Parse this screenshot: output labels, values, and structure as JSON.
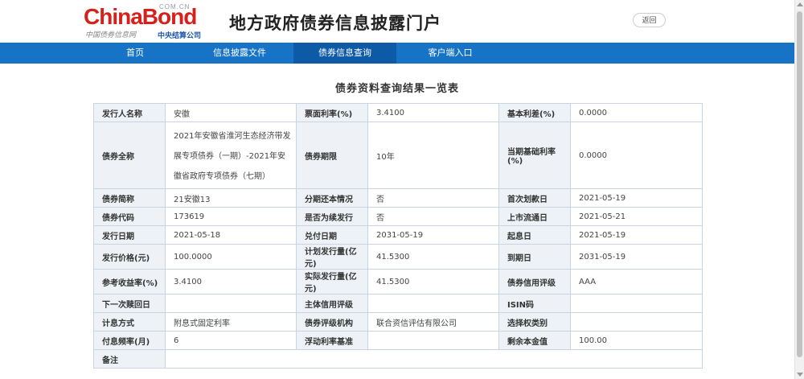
{
  "header": {
    "logo": {
      "brand_left": "China",
      "brand_right": "Bond",
      "domain": "COM.CN",
      "tagline_left": "中国债券信息网",
      "tagline_right": "中央结算公司"
    },
    "site_title": "地方政府债券信息披露门户",
    "back_label": "返回"
  },
  "nav": {
    "items": [
      {
        "label": "首页"
      },
      {
        "label": "信息披露文件"
      },
      {
        "label": "债券信息查询"
      },
      {
        "label": "客户端入口"
      }
    ],
    "active_index": 2
  },
  "page": {
    "title": "债券资料查询结果一览表"
  },
  "table": {
    "rows": [
      {
        "c": [
          "发行人名称",
          "安徽",
          "票面利率(%)",
          "3.4100",
          "基本利差(%)",
          "0.0000"
        ]
      },
      {
        "c": [
          "债券全称",
          "2021年安徽省淮河生态经济带发展专项债券（一期）-2021年安徽省政府专项债券（七期）",
          "债券期限",
          "10年",
          "当期基础利率(%)",
          "0.0000"
        ]
      },
      {
        "c": [
          "债券简称",
          "21安徽13",
          "分期还本情况",
          "否",
          "首次划款日",
          "2021-05-19"
        ]
      },
      {
        "c": [
          "债券代码",
          "173619",
          "是否为续发行",
          "否",
          "上市流通日",
          "2021-05-21"
        ]
      },
      {
        "c": [
          "发行日期",
          "2021-05-18",
          "兑付日期",
          "2031-05-19",
          "起息日",
          "2021-05-19"
        ]
      },
      {
        "c": [
          "发行价格(元)",
          "100.0000",
          "计划发行量(亿元)",
          "41.5300",
          "到期日",
          "2031-05-19"
        ]
      },
      {
        "c": [
          "参考收益率(%)",
          "3.4100",
          "实际发行量(亿元)",
          "41.5300",
          "债券信用评级",
          "AAA"
        ]
      },
      {
        "c": [
          "下一次赎回日",
          "",
          "主体信用评级",
          "",
          "ISIN码",
          ""
        ]
      },
      {
        "c": [
          "计息方式",
          "附息式固定利率",
          "债券评级机构",
          "联合资信评估有限公司",
          "选择权类别",
          ""
        ]
      },
      {
        "c": [
          "付息频率(月)",
          "6",
          "浮动利率基准",
          "",
          "剩余本金值",
          "100.00"
        ]
      },
      {
        "c": [
          "备注",
          ""
        ]
      }
    ]
  },
  "colors": {
    "nav_bg": "#1673c6",
    "nav_active": "#0d5aa7",
    "label_bg": "#eef2f7",
    "border": "#c9d4e2",
    "logo_red": "#d6201b"
  }
}
